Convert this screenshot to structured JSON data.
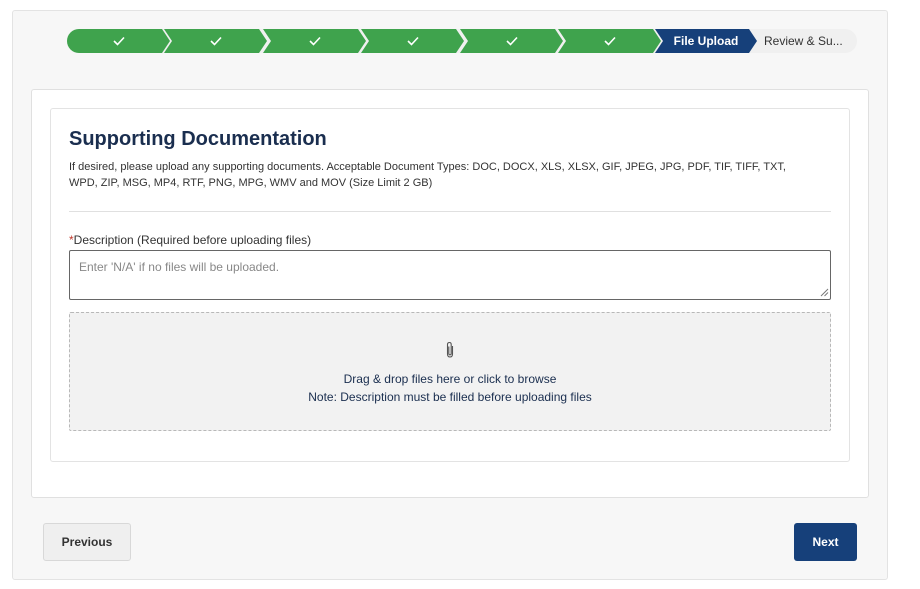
{
  "stepper": {
    "completed_steps": 6,
    "check_icon": "check-icon",
    "active_label": "File Upload",
    "pending_label": "Review & Su..."
  },
  "section": {
    "title": "Supporting Documentation",
    "description": "If desired, please upload any supporting documents. Acceptable Document Types: DOC, DOCX, XLS, XLSX, GIF, JPEG, JPG, PDF, TIF, TIFF, TXT, WPD, ZIP, MSG, MP4, RTF, PNG, MPG, WMV and MOV (Size Limit 2 GB)"
  },
  "description_field": {
    "required_marker": "*",
    "label": "Description (Required before uploading files)",
    "value": "",
    "placeholder": "Enter 'N/A' if no files will be uploaded."
  },
  "dropzone": {
    "icon": "paperclip-icon",
    "line1": "Drag & drop files here or click to browse",
    "line2": "Note: Description must be filled before uploading files"
  },
  "buttons": {
    "previous": "Previous",
    "next": "Next"
  },
  "colors": {
    "completed": "#3fa34d",
    "active": "#16407a",
    "primary": "#16407a"
  }
}
